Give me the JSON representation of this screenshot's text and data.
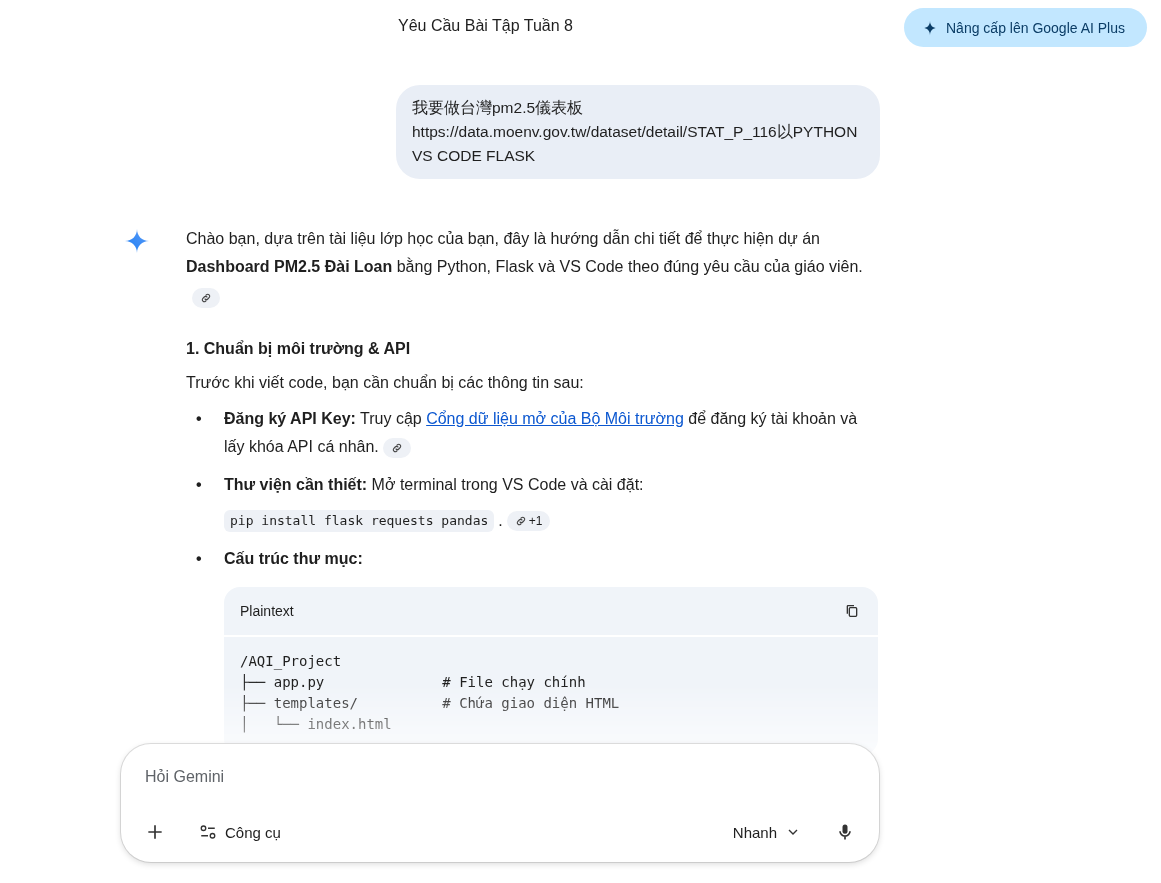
{
  "header": {
    "title": "Yêu Cầu Bài Tập Tuần 8",
    "upgrade_button": "Nâng cấp lên Google AI Plus"
  },
  "user_message": {
    "text": "我要做台灣pm2.5儀表板\nhttps://data.moenv.gov.tw/dataset/detail/STAT_P_116以PYTHON VS CODE FLASK"
  },
  "response": {
    "intro": "Chào bạn, dựa trên tài liệu lớp học của bạn, đây là hướng dẫn chi tiết để thực hiện dự án **Dashboard PM2.5 Đài Loan** bằng Python, Flask và VS Code theo đúng yêu cầu của giáo viên.",
    "intro_citation": true,
    "section_heading": "1. Chuẩn bị môi trường & API",
    "section_text": "Trước khi viết code, bạn cần chuẩn bị các thông tin sau:",
    "bullets": [
      {
        "kind": "link",
        "marker": "•",
        "label": "Đăng ký API Key:",
        "before": "Truy cập",
        "link": "Cổng dữ liệu mở của Bộ Môi trường",
        "after": "để đăng ký tài khoản và lấy khóa API cá nhân.",
        "citation": true
      },
      {
        "kind": "command",
        "marker": "•",
        "label": "Thư viện cần thiết:",
        "text": "Mở terminal trong VS Code và cài đặt:",
        "command": "pip install flask requests pandas",
        "punctuation": ".",
        "citation_count": "+1"
      },
      {
        "kind": "code",
        "marker": "•",
        "label": "Cấu trúc thư mục:",
        "code_block": {
          "language": "Plaintext",
          "lines": [
            "/AQI_Project",
            "├── app.py              # File chạy chính",
            "├── templates/          # Chứa giao diện HTML",
            "│   └── index.html"
          ]
        }
      }
    ]
  },
  "composer": {
    "placeholder": "Hỏi Gemini",
    "tools_label": "Công cụ",
    "mode": "Nhanh"
  }
}
